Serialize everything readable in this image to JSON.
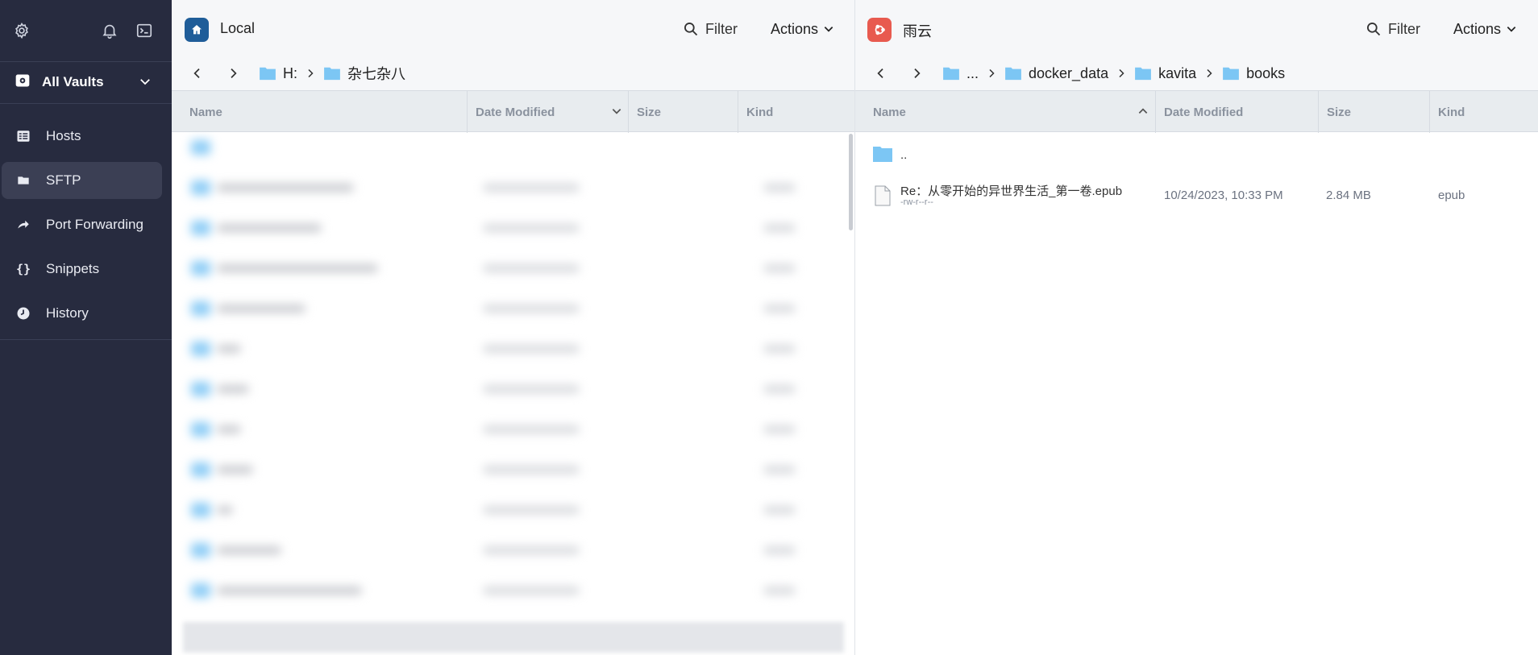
{
  "sidebar": {
    "top_icons": [
      "gear-icon",
      "bell-icon",
      "terminal-icon"
    ],
    "vault": {
      "label": "All Vaults",
      "icon": "vault-icon"
    },
    "items": [
      {
        "label": "Hosts",
        "icon": "hosts-icon",
        "active": false
      },
      {
        "label": "SFTP",
        "icon": "folder-icon",
        "active": true
      },
      {
        "label": "Port Forwarding",
        "icon": "port-forwarding-icon",
        "active": false
      },
      {
        "label": "Snippets",
        "icon": "braces-icon",
        "active": false
      },
      {
        "label": "History",
        "icon": "clock-icon",
        "active": false
      }
    ]
  },
  "left_pane": {
    "title": "Local",
    "icon_color": "#1f5d99",
    "filter_label": "Filter",
    "actions_label": "Actions",
    "breadcrumb": [
      "H:",
      "杂七杂八"
    ],
    "columns": [
      "Name",
      "Date Modified",
      "Size",
      "Kind"
    ]
  },
  "right_pane": {
    "title": "雨云",
    "icon_color": "#e85a4f",
    "filter_label": "Filter",
    "actions_label": "Actions",
    "breadcrumb": [
      "...",
      "docker_data",
      "kavita",
      "books"
    ],
    "columns": [
      "Name",
      "Date Modified",
      "Size",
      "Kind"
    ],
    "parent_row": {
      "name": ".."
    },
    "files": [
      {
        "name": "Re：从零开始的异世界生活_第一卷.epub",
        "permissions": "-rw-r--r--",
        "date_modified": "10/24/2023, 10:33 PM",
        "size": "2.84 MB",
        "kind": "epub"
      }
    ]
  },
  "colors": {
    "sidebar_bg": "#272b3f",
    "sidebar_active": "#3b3f54",
    "folder": "#7cc6f4",
    "header_bg": "#f6f7f9",
    "column_bg": "#e8ecef"
  }
}
